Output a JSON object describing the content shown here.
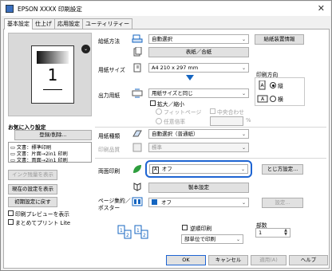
{
  "window": {
    "title": "EPSON XXXX 印刷設定"
  },
  "tabs": [
    "基本設定",
    "仕上げ",
    "応用設定",
    "ユーティリティー"
  ],
  "preview": {
    "page_number": "1"
  },
  "favorites": {
    "title": "お気に入り設定",
    "register_button": "登録/削除...",
    "items": [
      "文書：標準印刷",
      "文書：片面→2in1 印刷",
      "文書：両面→2in1 印刷"
    ]
  },
  "left_buttons": {
    "ink": "インク残量を表示",
    "show_current": "現在の設定を表示",
    "reset": "初期設定に戻す"
  },
  "left_checks": {
    "preview": "印刷プレビューを表示",
    "lite": "まとめてプリント Lite"
  },
  "paper_source": {
    "label": "給紙方法",
    "value": "自動選択",
    "info_button": "給紙装置情報",
    "front_back_button": "表紙／合紙"
  },
  "paper_size": {
    "label": "用紙サイズ",
    "value": "A4 210 x 297 mm"
  },
  "orientation": {
    "title": "印刷方向",
    "portrait": "縦",
    "landscape": "横"
  },
  "output_paper": {
    "label": "出力用紙",
    "value": "用紙サイズと同じ",
    "reduce": "拡大／縮小",
    "fit_page": "フィットページ",
    "center": "中央合わせ",
    "any_scale": "任意倍率",
    "percent": "%"
  },
  "paper_type": {
    "label": "用紙種類",
    "value": "自動選択（普通紙）"
  },
  "quality": {
    "label": "印刷品質",
    "value": "標準"
  },
  "duplex": {
    "label": "両面印刷",
    "value": "オフ",
    "binding_button": "とじ方設定...",
    "booklet_button": "製本設定"
  },
  "nup": {
    "label_line1": "ページ集約／",
    "label_line2": "ポスター",
    "value": "オフ",
    "settings_button": "設定..."
  },
  "reverse": {
    "label": "逆順印刷",
    "collate": "部単位で印刷"
  },
  "copies": {
    "label": "部数",
    "value": "1"
  },
  "footer": {
    "ok": "OK",
    "cancel": "キャンセル",
    "apply": "適用(A)",
    "help": "ヘルプ"
  },
  "colors": {
    "accent": "#1565c0",
    "highlight": "#1e64d2"
  }
}
